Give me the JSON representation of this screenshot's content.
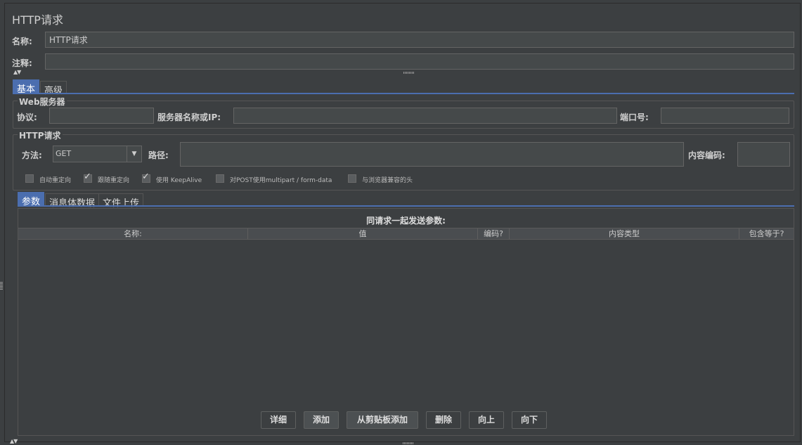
{
  "header": {
    "title": "HTTP请求"
  },
  "name_row": {
    "label": "名称:",
    "value": "HTTP请求"
  },
  "comment_row": {
    "label": "注释:",
    "value": ""
  },
  "tabs": [
    {
      "label": "基本",
      "active": true
    },
    {
      "label": "高级",
      "active": false
    }
  ],
  "web_server": {
    "group_title": "Web服务器",
    "protocol_label": "协议:",
    "protocol_value": "",
    "server_label": "服务器名称或IP:",
    "server_value": "",
    "port_label": "端口号:",
    "port_value": ""
  },
  "http_request": {
    "group_title": "HTTP请求",
    "method_label": "方法:",
    "method_value": "GET",
    "path_label": "路径:",
    "path_value": "",
    "encoding_label": "内容编码:",
    "encoding_value": ""
  },
  "options": [
    {
      "label": "自动重定向",
      "checked": false
    },
    {
      "label": "跟随重定向",
      "checked": true
    },
    {
      "label": "使用 KeepAlive",
      "checked": true
    },
    {
      "label": "对POST使用multipart / form-data",
      "checked": false
    },
    {
      "label": "与浏览器兼容的头",
      "checked": false
    }
  ],
  "sub_tabs": [
    {
      "label": "参数",
      "active": true
    },
    {
      "label": "消息体数据",
      "active": false
    },
    {
      "label": "文件上传",
      "active": false
    }
  ],
  "params_table": {
    "caption": "同请求一起发送参数:",
    "columns": [
      "名称:",
      "值",
      "编码?",
      "内容类型",
      "包含等于?"
    ],
    "rows": []
  },
  "buttons": {
    "detail": "详细",
    "add": "添加",
    "add_clipboard": "从剪贴板添加",
    "delete": "删除",
    "up": "向上",
    "down": "向下"
  },
  "colors": {
    "accent": "#4b6eaf",
    "background": "#3c3f41",
    "field": "#45494a"
  }
}
